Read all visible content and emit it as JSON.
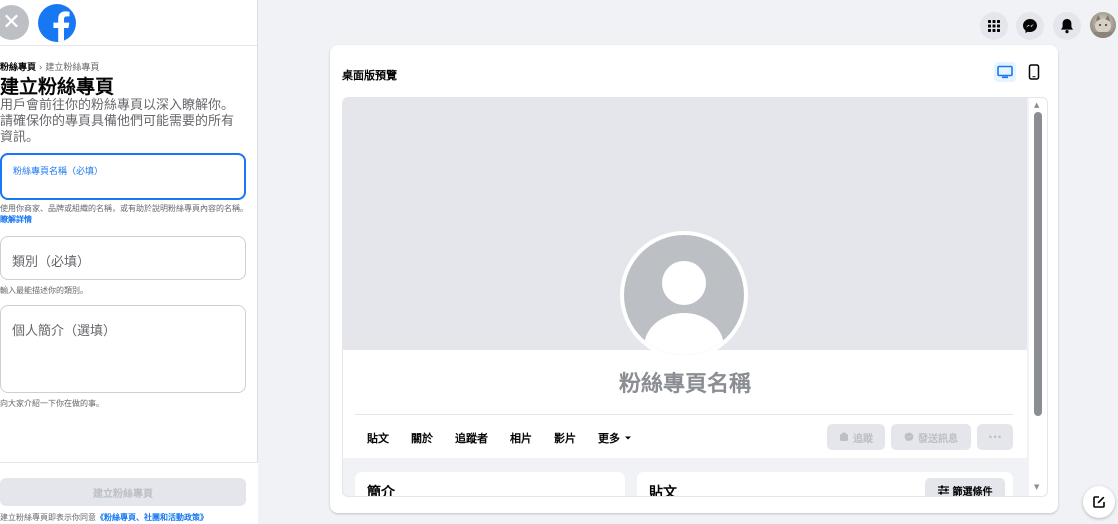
{
  "left_panel": {
    "breadcrumb_parent": "粉絲專頁",
    "breadcrumb_sep": "›",
    "breadcrumb_current": "建立粉絲專頁",
    "title": "建立粉絲專頁",
    "intro": "用戶會前往你的粉絲專頁以深入瞭解你。請確保你的專頁具備他們可能需要的所有資訊。",
    "name_field_label": "粉絲專頁名稱（必填）",
    "name_help": "使用你商家、品牌或組織的名稱，或有助於說明粉絲專頁內容的名稱。",
    "name_help_link": "瞭解詳情",
    "category_placeholder": "類別（必填）",
    "category_help": "輸入最能描述你的類別。",
    "bio_placeholder": "個人簡介（選填）",
    "bio_help": "向大家介紹一下你在做的事。",
    "create_button": "建立粉絲專頁",
    "terms_text": "建立粉絲專頁即表示你同意",
    "terms_link": "《粉絲專頁、社團和活動政策》"
  },
  "top_bar": {
    "icons": [
      "menu-grid-icon",
      "messenger-icon",
      "notifications-bell-icon",
      "account-avatar"
    ]
  },
  "preview": {
    "title": "桌面版預覽",
    "page_name": "粉絲專頁名稱",
    "tabs": [
      "貼文",
      "關於",
      "追蹤者",
      "相片",
      "影片",
      "更多"
    ],
    "follow_button": "追蹤",
    "message_button": "發送訊息",
    "more_button": "···",
    "intro_card_title": "簡介",
    "posts_card_title": "貼文",
    "filter_button": "篩選條件"
  },
  "colors": {
    "accent": "#1877f2",
    "background": "#f0f2f5",
    "disabled_button": "#e4e6eb",
    "secondary_text": "#65676b"
  }
}
